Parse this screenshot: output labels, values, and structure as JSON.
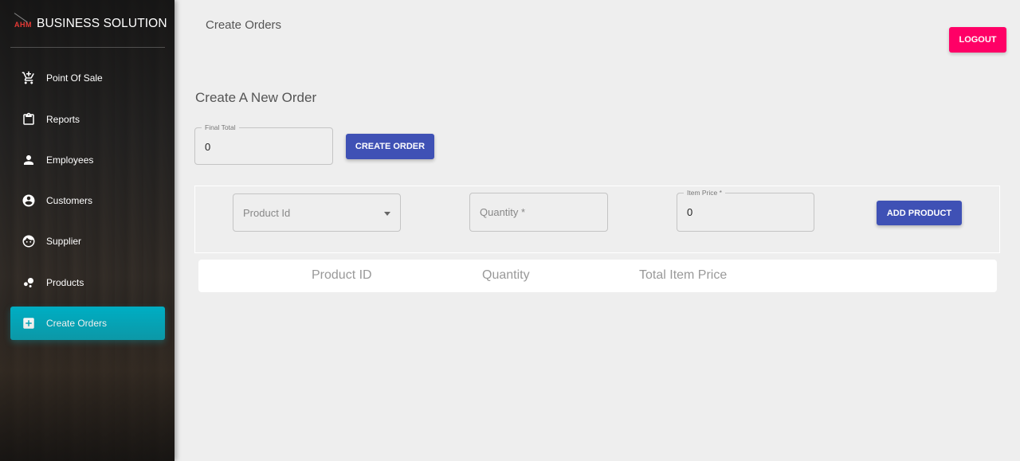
{
  "brand": {
    "logo_text": "AHM",
    "title": "BUSINESS SOLUTION"
  },
  "sidebar": {
    "items": [
      {
        "label": "Point Of Sale",
        "icon": "cart-icon",
        "active": false
      },
      {
        "label": "Reports",
        "icon": "clipboard-icon",
        "active": false
      },
      {
        "label": "Employees",
        "icon": "person-icon",
        "active": false
      },
      {
        "label": "Customers",
        "icon": "account-circle-icon",
        "active": false
      },
      {
        "label": "Supplier",
        "icon": "face-icon",
        "active": false
      },
      {
        "label": "Products",
        "icon": "bubble-chart-icon",
        "active": false
      },
      {
        "label": "Create Orders",
        "icon": "add-box-icon",
        "active": true
      }
    ]
  },
  "header": {
    "title": "Create Orders",
    "logout_label": "LOGOUT"
  },
  "order": {
    "section_title": "Create A New Order",
    "final_total_label": "Final Total",
    "final_total_value": "0",
    "create_order_label": "CREATE ORDER"
  },
  "product_form": {
    "product_id_placeholder": "Product Id",
    "quantity_placeholder": "Quantity *",
    "item_price_label": "Item Price *",
    "item_price_value": "0",
    "add_product_label": "ADD PRODUCT"
  },
  "table": {
    "columns": [
      "Product ID",
      "Quantity",
      "Total Item Price"
    ]
  },
  "colors": {
    "accent_active": "#00acc1",
    "primary_button": "#3f51b5",
    "logout_button": "#ff0066",
    "brand_logo": "#e53935"
  }
}
